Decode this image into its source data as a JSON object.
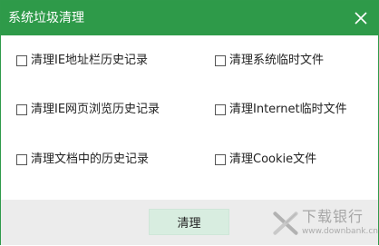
{
  "window": {
    "title": "系统垃圾清理"
  },
  "options": [
    {
      "label": "清理IE地址栏历史记录",
      "checked": false
    },
    {
      "label": "清理系统临时文件",
      "checked": false
    },
    {
      "label": "清理IE网页浏览历史记录",
      "checked": false
    },
    {
      "label": "清理Internet临时文件",
      "checked": false
    },
    {
      "label": "清理文档中的历史记录",
      "checked": false
    },
    {
      "label": "清理Cookie文件",
      "checked": false
    }
  ],
  "buttons": {
    "clean_label": "清理"
  },
  "watermark": {
    "name": "下载银行",
    "url": "www.downbank.cn",
    "icon": "downbank-logo-icon"
  },
  "colors": {
    "titlebar": "#2e9a49",
    "button": "#d8ede0",
    "footer": "#ececec"
  }
}
